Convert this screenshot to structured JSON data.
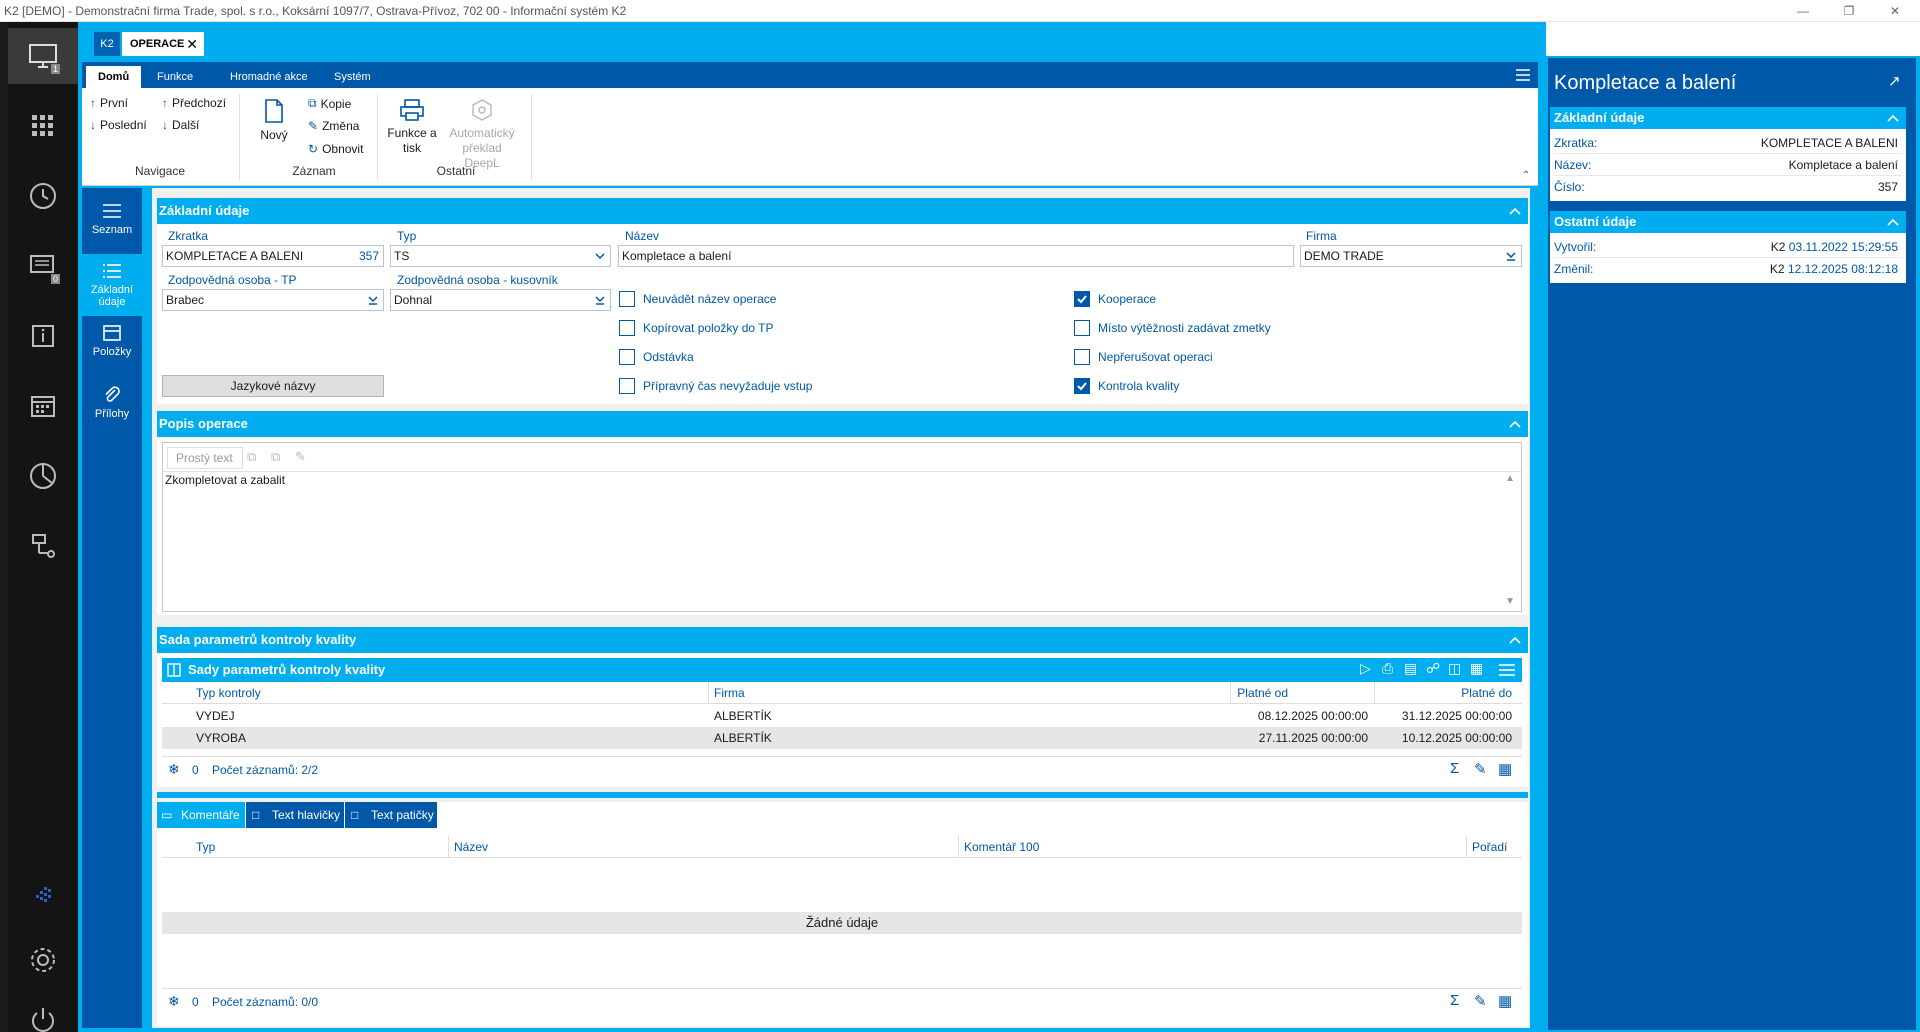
{
  "window": {
    "title": "K2 [DEMO] - Demonstrační firma Trade, spol. s r.o., Koksární 1097/7, Ostrava-Přívoz, 702 00 - Informační systém K2"
  },
  "sidebar": {
    "badges": [
      "1",
      "0"
    ]
  },
  "tabs": {
    "k2": "K2",
    "operace": "OPERACE"
  },
  "menu": [
    "Domů",
    "Funkce",
    "Hromadné akce",
    "Systém"
  ],
  "ribbon": {
    "nav": {
      "first": "První",
      "prev": "Předchozí",
      "last": "Poslední",
      "next": "Další",
      "group": "Navigace"
    },
    "record": {
      "new": "Nový",
      "copy": "Kopie",
      "change": "Změna",
      "refresh": "Obnovit",
      "group": "Záznam"
    },
    "other": {
      "print": [
        "Funkce a",
        "tisk"
      ],
      "deepl": [
        "Automatický",
        "překlad DeepL"
      ],
      "group": "Ostatní"
    }
  },
  "sidenav": [
    {
      "label": [
        "Seznam"
      ]
    },
    {
      "label": [
        "Základní",
        "údaje"
      ]
    },
    {
      "label": [
        "Položky"
      ]
    },
    {
      "label": [
        "Přílohy"
      ]
    }
  ],
  "basic": {
    "title": "Základní údaje",
    "zkratka_label": "Zkratka",
    "zkratka": "KOMPLETACE A BALENI",
    "zkratka_num": "357",
    "typ_label": "Typ",
    "typ": "TS",
    "nazev_label": "Název",
    "nazev": "Kompletace a balení",
    "firma_label": "Firma",
    "firma": "DEMO TRADE",
    "tp_label": "Zodpovědná osoba - TP",
    "tp": "Brabec",
    "kus_label": "Zodpovědná osoba - kusovník",
    "kus": "Dohnal",
    "lang_button": "Jazykové názvy",
    "checks_left": [
      {
        "label": "Neuvádět název operace",
        "checked": false
      },
      {
        "label": "Kopírovat položky do TP",
        "checked": false
      },
      {
        "label": "Odstávka",
        "checked": false
      },
      {
        "label": "Přípravný čas nevyžaduje vstup",
        "checked": false
      }
    ],
    "checks_right": [
      {
        "label": "Kooperace",
        "checked": true
      },
      {
        "label": "Místo výtěžnosti zadávat zmetky",
        "checked": false
      },
      {
        "label": "Nepřerušovat operaci",
        "checked": false
      },
      {
        "label": "Kontrola kvality",
        "checked": true
      }
    ]
  },
  "popis": {
    "title": "Popis operace",
    "format": "Prostý text",
    "text": "Zkompletovat a zabalit"
  },
  "quality": {
    "title": "Sada parametrů kontroly kvality",
    "grid_title": "Sady parametrů kontroly kvality",
    "columns": [
      "Typ kontroly",
      "Firma",
      "Platné od",
      "Platné do"
    ],
    "rows": [
      [
        "VYDEJ",
        "ALBERTÍK",
        "08.12.2025 00:00:00",
        "31.12.2025 00:00:00"
      ],
      [
        "VYROBA",
        "ALBERTÍK",
        "27.11.2025 00:00:00",
        "10.12.2025 00:00:00"
      ]
    ],
    "filter_count": "0",
    "record_count": "Počet záznamů: 2/2"
  },
  "bottom": {
    "tabs": [
      "Komentáře",
      "Text hlavičky",
      "Text patičky"
    ],
    "columns": [
      "Typ",
      "Název",
      "Komentář 100",
      "Pořadí"
    ],
    "empty": "Žádné údaje",
    "filter_count": "0",
    "record_count": "Počet záznamů: 0/0"
  },
  "right": {
    "title": "Kompletace a balení",
    "sec1": "Základní údaje",
    "rows1": [
      {
        "k": "Zkratka:",
        "v": "KOMPLETACE A BALENI"
      },
      {
        "k": "Název:",
        "v": "Kompletace a balení"
      },
      {
        "k": "Číslo:",
        "v": "357"
      }
    ],
    "sec2": "Ostatní údaje",
    "rows2": [
      {
        "k": "Vytvořil:",
        "user": "K2",
        "v": "03.11.2022 15:29:55"
      },
      {
        "k": "Změnil:",
        "user": "K2",
        "v": "12.12.2025 08:12:18"
      }
    ]
  }
}
